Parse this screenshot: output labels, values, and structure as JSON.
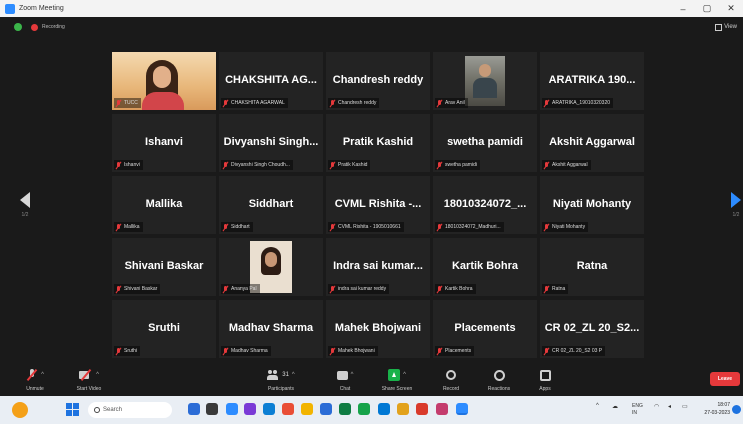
{
  "window": {
    "title": "Zoom Meeting",
    "minimize": "–",
    "maximize": "▢",
    "close": "✕"
  },
  "status": {
    "recording_label": "Recording",
    "view_label": "View"
  },
  "gallery": {
    "tiles": [
      {
        "type": "video",
        "label": "TUCC"
      },
      {
        "name": "CHAKSHITA AG...",
        "label": "CHAKSHITA AGARWAL"
      },
      {
        "name": "Chandresh reddy",
        "label": "Chandresh reddy"
      },
      {
        "type": "photo",
        "label": "Arav Anil"
      },
      {
        "name": "ARATRIKA 190...",
        "label": "ARATRIKA_19010320320"
      },
      {
        "name": "Ishanvi",
        "label": "Ishanvi"
      },
      {
        "name": "Divyanshi Singh...",
        "label": "Divyanshi Singh Choudh..."
      },
      {
        "name": "Pratik Kashid",
        "label": "Pratik Kashid"
      },
      {
        "name": "swetha pamidi",
        "label": "swetha pamidi"
      },
      {
        "name": "Akshit Aggarwal",
        "label": "Akshit Aggarwal"
      },
      {
        "name": "Mallika",
        "label": "Mallika"
      },
      {
        "name": "Siddhart",
        "label": "Siddhart"
      },
      {
        "name": "CVML Rishita -...",
        "label": "CVML Rishita - 1905010661"
      },
      {
        "name": "18010324072_...",
        "label": "18010324072_Madhuri..."
      },
      {
        "name": "Niyati Mohanty",
        "label": "Niyati Mohanty"
      },
      {
        "name": "Shivani Baskar",
        "label": "Shivani Baskar"
      },
      {
        "type": "photo2",
        "label": "Ananya Pal"
      },
      {
        "name": "Indra sai kumar...",
        "label": "indra sai kumar reddy"
      },
      {
        "name": "Kartik Bohra",
        "label": "Kartik Bohra"
      },
      {
        "name": "Ratna",
        "label": "Ratna"
      },
      {
        "name": "Sruthi",
        "label": "Sruthi"
      },
      {
        "name": "Madhav Sharma",
        "label": "Madhav Sharma"
      },
      {
        "name": "Mahek Bhojwani",
        "label": "Mahek Bhojwani"
      },
      {
        "name": "Placements",
        "label": "Placements"
      },
      {
        "name": "CR 02_ZL 20_S2...",
        "label": "CR 02_ZL 20_S2 03 P"
      }
    ],
    "page_left": "1/2",
    "page_right": "1/2"
  },
  "toolbar": {
    "unmute": "Unmute",
    "start_video": "Start Video",
    "participants": "Participants",
    "participants_count": "31",
    "chat": "Chat",
    "share_screen": "Share Screen",
    "record": "Record",
    "reactions": "Reactions",
    "apps": "Apps",
    "leave": "Leave"
  },
  "taskbar": {
    "search_placeholder": "Search",
    "lang": "ENG\nIN",
    "time": "18:07",
    "date": "27-03-2023"
  },
  "colors": {
    "accent": "#2d8cff",
    "mute_red": "#e5393b",
    "share_green": "#19b24a",
    "tile_bg": "#232323"
  }
}
